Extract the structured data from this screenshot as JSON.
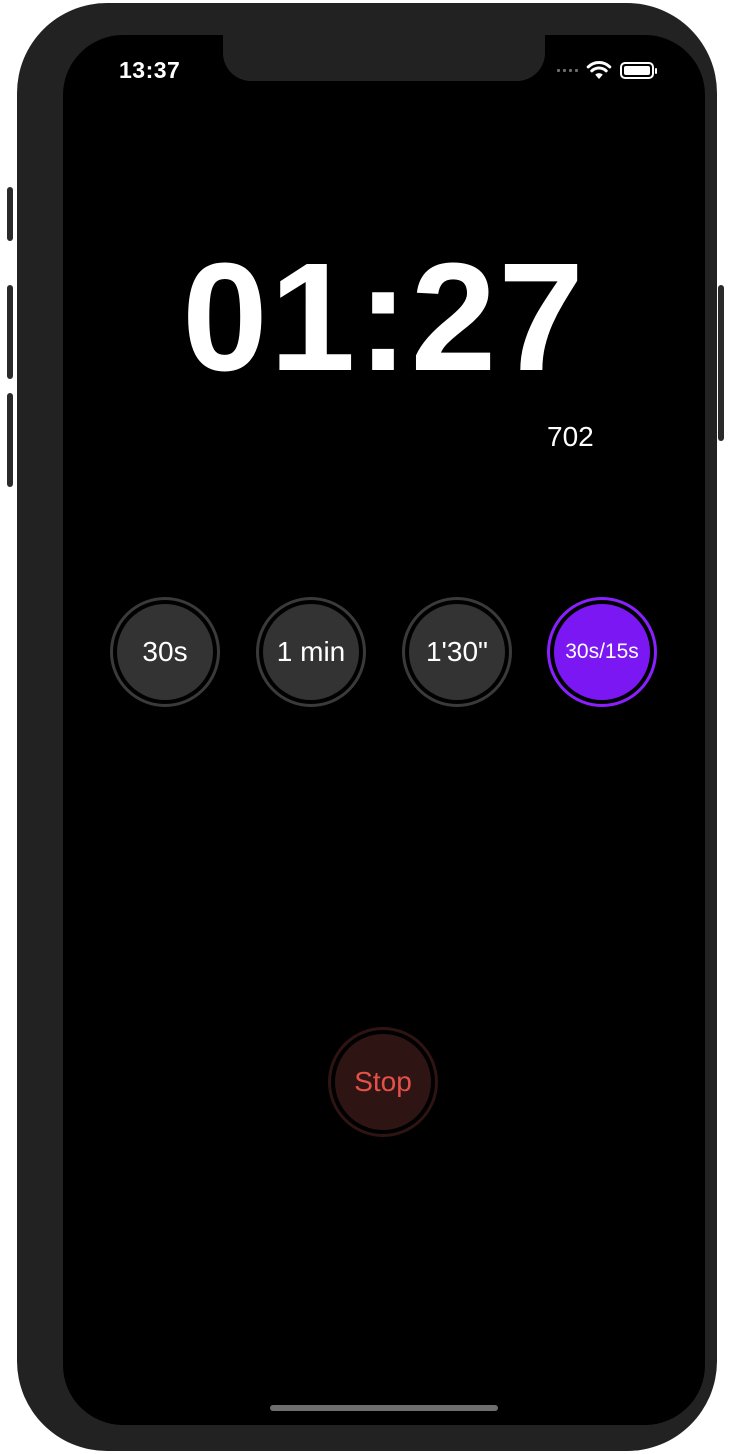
{
  "status_bar": {
    "time": "13:37"
  },
  "timer": {
    "display": "01:27",
    "count": "702"
  },
  "presets": [
    {
      "label": "30s",
      "active": false
    },
    {
      "label": "1 min",
      "active": false
    },
    {
      "label": "1'30\"",
      "active": false
    },
    {
      "label": "30s/15s",
      "active": true
    }
  ],
  "controls": {
    "stop_label": "Stop"
  },
  "colors": {
    "accent": "#7b17f2",
    "stop_text": "#e5514a",
    "stop_bg": "#2e1513",
    "preset_bg": "#333333"
  },
  "icons": [
    "signal-dots-icon",
    "wifi-icon",
    "battery-icon"
  ]
}
